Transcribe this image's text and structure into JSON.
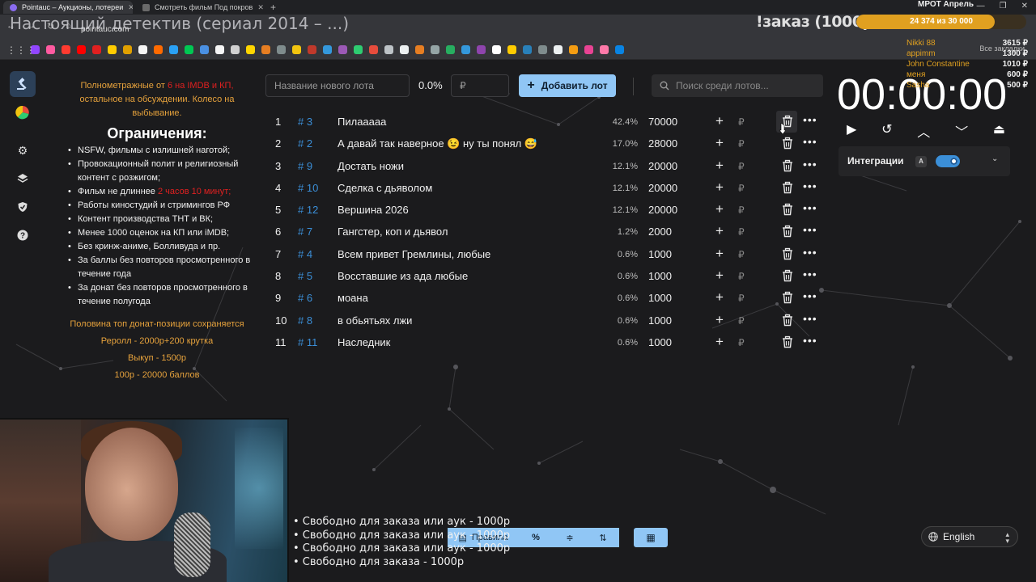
{
  "browser": {
    "tabs": [
      {
        "title": "Pointauc – Аукционы, лотереи",
        "active": true
      },
      {
        "title": "Смотреть фильм Под покров",
        "active": false
      }
    ],
    "url": "pointauc.com",
    "all_bookmarks": "Все закладки"
  },
  "stream_overlay": {
    "movie_title": "Настоящий детектив (сериал 2014 – ...)",
    "order_label": "!заказ (1000р)",
    "goal_title": "МРОТ Апрель",
    "goal_current": "24 374",
    "goal_text": "24 374  из 30 000",
    "goal_fraction": 0.812,
    "donors": [
      {
        "name": "Nikki 88",
        "amount": "3615 ₽"
      },
      {
        "name": "appimm",
        "amount": "1300 ₽"
      },
      {
        "name": "John Constantine",
        "amount": "1010 ₽"
      },
      {
        "name": "меня",
        "amount": "600 ₽"
      },
      {
        "name": "Sasha",
        "amount": "500 ₽"
      }
    ],
    "free_lines": [
      "• Свободно для заказа или аук - 1000р",
      "• Свободно для заказа или аук - 1000р",
      "• Свободно для заказа или аук - 1000р",
      "• Свободно для заказа - 1000р"
    ]
  },
  "sidebar": {
    "items": [
      {
        "icon": "hammer-icon",
        "active": true
      },
      {
        "icon": "wheel-icon",
        "active": false
      },
      {
        "icon": "gear-icon",
        "active": false
      },
      {
        "icon": "layers-icon",
        "active": false
      },
      {
        "icon": "shield-icon",
        "active": false
      },
      {
        "icon": "help-icon",
        "active": false
      }
    ]
  },
  "rules": {
    "intro_a": "Полнометражные от ",
    "intro_red": "6 на IMDB и КП,",
    "intro_b": " остальное на обсуждении. Колесо на выбывание.",
    "title": "Ограничения:",
    "items": [
      "NSFW, фильмы с излишней наготой;",
      "Провокационный полит и религиозный контент с розжигом;",
      "Фильм не длиннее ",
      "Работы киностудий и стримингов РФ",
      "Контент производства ТНТ и ВК;",
      "Менее 1000 оценок на КП или iMDB;",
      "Без кринж-аниме, Болливуда и пр.",
      "За баллы без повторов просмотренного в течение года",
      "За донат без повторов просмотренного в течение полугода"
    ],
    "length_limit": "2 часов 10 минут;",
    "footer": [
      "Половина топ донат-позиции сохраняется",
      "Реролл - 2000р+200 крутка",
      "Выкуп - 1500р",
      "100р - 20000 баллов"
    ]
  },
  "add_lot": {
    "name_placeholder": "Название нового лота",
    "percent": "0.0%",
    "amount_placeholder": "₽",
    "add_button": "Добавить лот",
    "search_placeholder": "Поиск среди лотов..."
  },
  "lots": [
    {
      "n": "1",
      "id": "# 3",
      "name": "Пилааааа",
      "pct": "42.4%",
      "amount": "70000"
    },
    {
      "n": "2",
      "id": "# 2",
      "name": "А давай так наверное 😉 ну ты понял 😅",
      "pct": "17.0%",
      "amount": "28000"
    },
    {
      "n": "3",
      "id": "# 9",
      "name": "Достать ножи",
      "pct": "12.1%",
      "amount": "20000"
    },
    {
      "n": "4",
      "id": "# 10",
      "name": "Сделка с дьяволом",
      "pct": "12.1%",
      "amount": "20000"
    },
    {
      "n": "5",
      "id": "# 12",
      "name": "Вершина 2026",
      "pct": "12.1%",
      "amount": "20000"
    },
    {
      "n": "6",
      "id": "# 7",
      "name": "Гангстер, коп и дьявол",
      "pct": "1.2%",
      "amount": "2000"
    },
    {
      "n": "7",
      "id": "# 4",
      "name": "Всем привет Гремлины, любые",
      "pct": "0.6%",
      "amount": "1000"
    },
    {
      "n": "8",
      "id": "# 5",
      "name": "Восставшие из ада  любые",
      "pct": "0.6%",
      "amount": "1000"
    },
    {
      "n": "9",
      "id": "# 6",
      "name": "моана",
      "pct": "0.6%",
      "amount": "1000"
    },
    {
      "n": "10",
      "id": "# 8",
      "name": "в обьятьях лжи",
      "pct": "0.6%",
      "amount": "1000"
    },
    {
      "n": "11",
      "id": "# 11",
      "name": "Наследник",
      "pct": "0.6%",
      "amount": "1000"
    }
  ],
  "lot_currency": "₽",
  "timer": {
    "display": "00:00:00"
  },
  "integrations": {
    "label": "Интеграции",
    "badge": "A",
    "enabled": true
  },
  "bottom_toolbar": {
    "rules_label": "Правила",
    "percent_label": "%"
  },
  "language": {
    "selected": "English"
  },
  "colors": {
    "accent": "#90c6f5",
    "lot_id": "#3b8fd8",
    "gold": "#e6a23c",
    "red": "#e02020"
  }
}
